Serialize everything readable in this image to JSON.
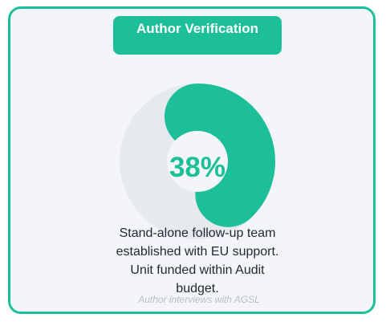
{
  "title": "Author Verification",
  "chart_data": {
    "type": "gauge",
    "value": 38,
    "max": 100,
    "label": "38%",
    "track_color": "#e6e9ed",
    "fill_color": "#1dbf98"
  },
  "description": "Stand-alone follow-up team established with EU support. Unit funded within Audit budget.",
  "footnote": "Author interviews with AGSL"
}
